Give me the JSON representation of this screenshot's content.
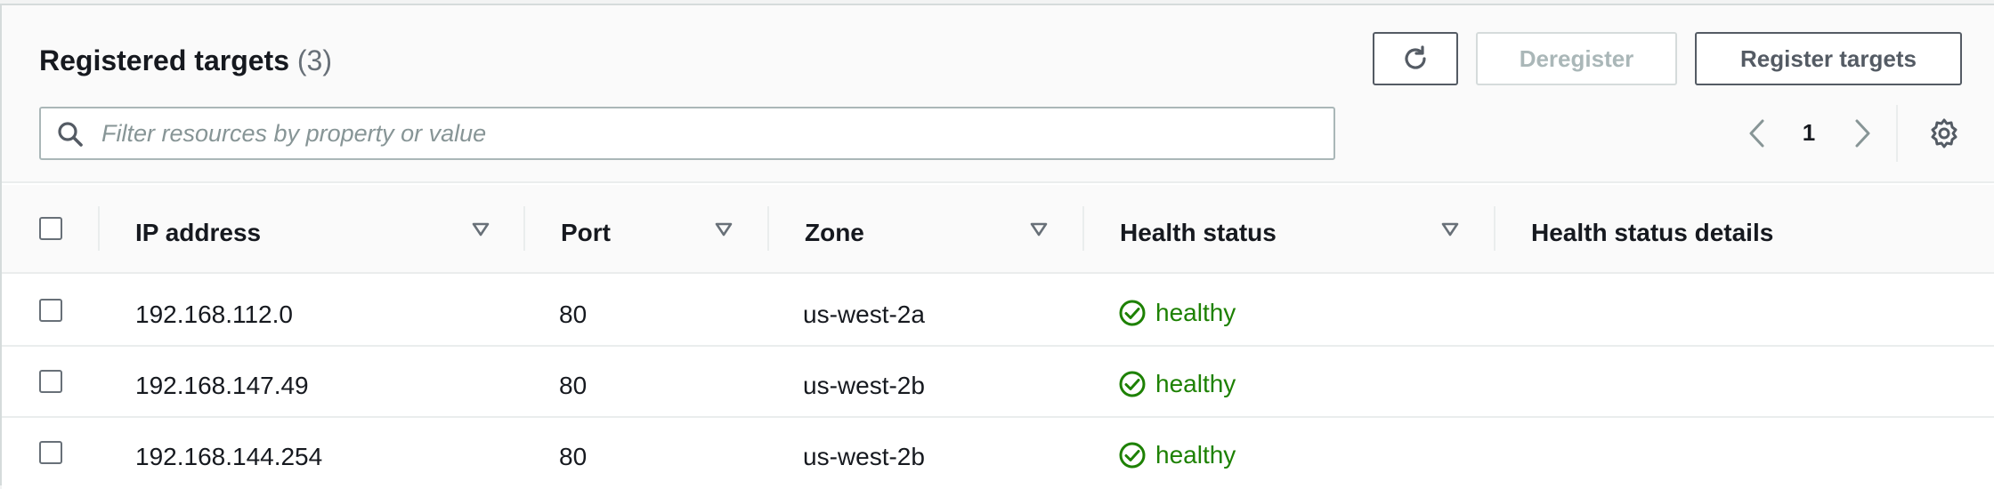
{
  "header": {
    "title": "Registered targets",
    "count": "(3)"
  },
  "toolbar": {
    "refresh_icon": "refresh-icon",
    "deregister_label": "Deregister",
    "register_label": "Register targets"
  },
  "search": {
    "placeholder": "Filter resources by property or value",
    "value": ""
  },
  "pagination": {
    "current_page": "1"
  },
  "table": {
    "columns": [
      "IP address",
      "Port",
      "Zone",
      "Health status",
      "Health status details"
    ],
    "rows": [
      {
        "ip": "192.168.112.0",
        "port": "80",
        "zone": "us-west-2a",
        "health": "healthy",
        "details": ""
      },
      {
        "ip": "192.168.147.49",
        "port": "80",
        "zone": "us-west-2b",
        "health": "healthy",
        "details": ""
      },
      {
        "ip": "192.168.144.254",
        "port": "80",
        "zone": "us-west-2b",
        "health": "healthy",
        "details": ""
      }
    ]
  },
  "colors": {
    "healthy": "#1d8102",
    "border": "#545b64",
    "disabled": "#aab7b8"
  }
}
